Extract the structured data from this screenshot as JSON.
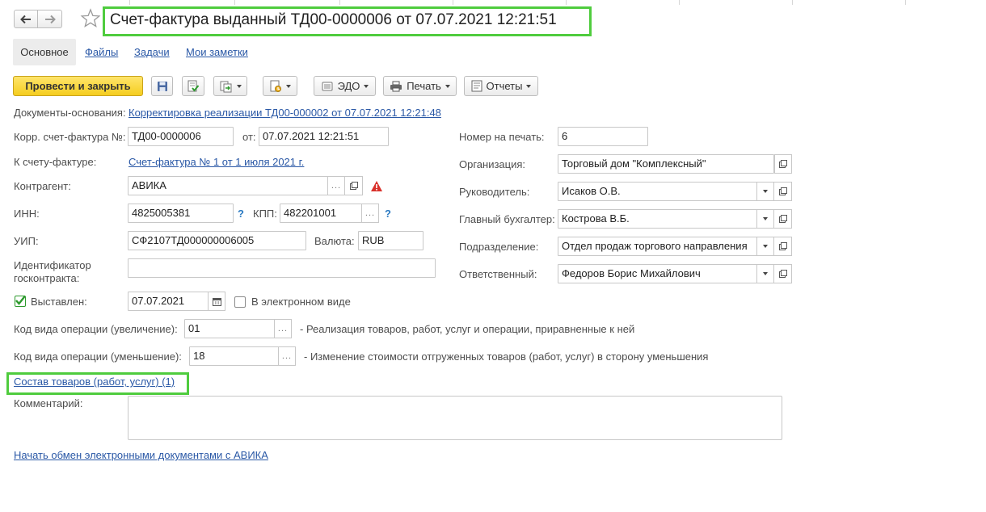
{
  "title": "Счет-фактура выданный ТД00-0000006 от 07.07.2021 12:21:51",
  "tabs": [
    {
      "label": "Основное"
    },
    {
      "label": "Файлы"
    },
    {
      "label": "Задачи"
    },
    {
      "label": "Мои заметки"
    }
  ],
  "toolbar": {
    "post_close_label": "Провести и закрыть",
    "edo_label": "ЭДО",
    "print_label": "Печать",
    "reports_label": "Отчеты"
  },
  "form": {
    "base_docs_label": "Документы-основания:",
    "base_docs_link": "Корректировка реализации ТД00-000002 от 07.07.2021 12:21:48",
    "corr_invoice_label": "Корр. счет-фактура №:",
    "corr_invoice_number": "ТД00-0000006",
    "from_label": "от:",
    "corr_invoice_date": "07.07.2021 12:21:51",
    "to_invoice_label": "К счету-фактуре:",
    "to_invoice_link": "Счет-фактура № 1 от 1 июля 2021 г.",
    "counterparty_label": "Контрагент:",
    "counterparty": "АВИКА",
    "inn_label": "ИНН:",
    "inn": "4825005381",
    "kpp_label": "КПП:",
    "kpp": "482201001",
    "uip_label": "УИП:",
    "uip": "СФ2107ТД000000006005",
    "currency_label": "Валюта:",
    "currency": "RUB",
    "contract_id_label_1": "Идентификатор",
    "contract_id_label_2": "госконтракта:",
    "contract_id": "",
    "issued_label": "Выставлен:",
    "issued_date": "07.07.2021",
    "electronic_label": "В электронном виде",
    "op_code_inc_label": "Код вида операции (увеличение):",
    "op_code_inc": "01",
    "op_code_inc_desc": "- Реализация товаров, работ, услуг и операции, приравненные к ней",
    "op_code_dec_label": "Код вида операции (уменьшение):",
    "op_code_dec": "18",
    "op_code_dec_desc": "- Изменение стоимости отгруженных товаров (работ, услуг) в сторону уменьшения",
    "goods_link": "Состав товаров (работ, услуг) (1)",
    "comment_label": "Комментарий:",
    "comment": "",
    "exchange_link": "Начать обмен электронными документами с АВИКА",
    "print_number_label": "Номер на печать:",
    "print_number": "6",
    "org_label": "Организация:",
    "org": "Торговый дом \"Комплексный\"",
    "manager_label": "Руководитель:",
    "manager": "Исаков О.В.",
    "accountant_label": "Главный бухгалтер:",
    "accountant": "Кострова В.Б.",
    "department_label": "Подразделение:",
    "department": "Отдел продаж торгового направления",
    "responsible_label": "Ответственный:",
    "responsible": "Федоров Борис Михайлович"
  },
  "colors": {
    "highlight": "#4fcc3e",
    "primary_button": "#f5cd1f",
    "link": "#2a58a6",
    "warning": "#d9312b"
  }
}
